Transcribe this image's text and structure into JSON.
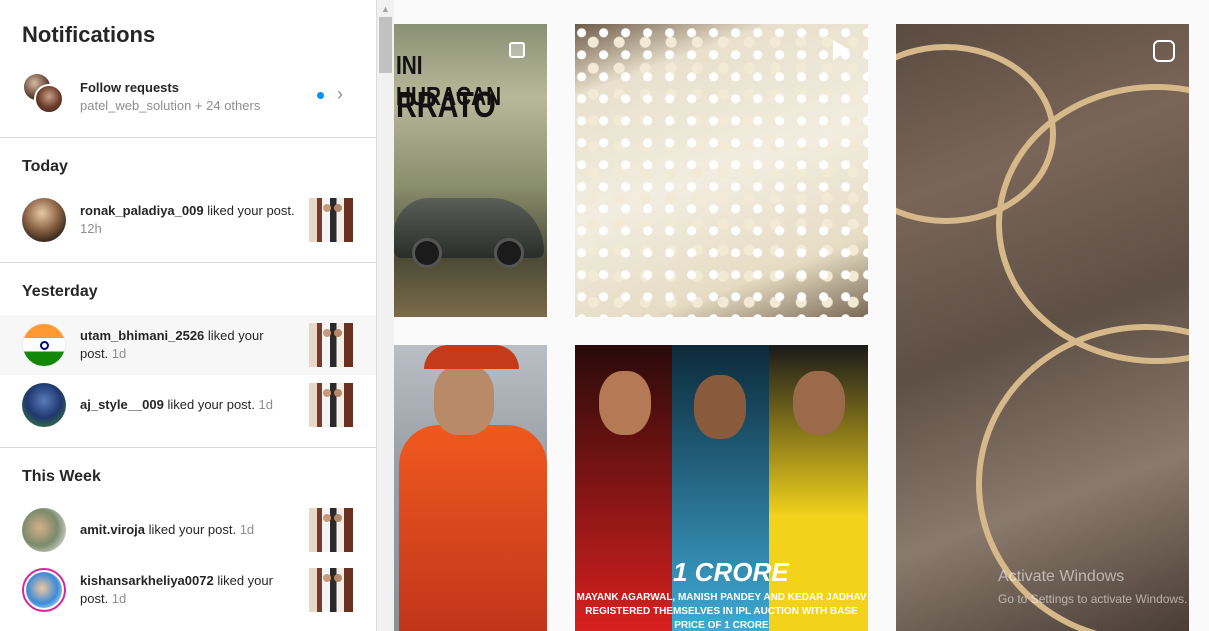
{
  "notifications": {
    "title": "Notifications",
    "follow_requests": {
      "title": "Follow requests",
      "subtitle": "patel_web_solution + 24 others"
    },
    "sections": {
      "today": "Today",
      "yesterday": "Yesterday",
      "this_week": "This Week"
    },
    "items": [
      {
        "username": "ronak_paladiya_009",
        "action": " liked your post.",
        "time": " 12h"
      },
      {
        "username": "utam_bhimani_2526",
        "action": " liked your post.",
        "time": " 1d"
      },
      {
        "username": "aj_style__009",
        "action": " liked your post.",
        "time": " 1d"
      },
      {
        "username": "amit.viroja",
        "action": " liked your post.",
        "time": " 1d"
      },
      {
        "username": "kishansarkheliya0072",
        "action": " liked your post.",
        "time": " 1d"
      }
    ]
  },
  "feed": {
    "car_title_line1": "INI HURACAN",
    "car_title_line2": "RRATO",
    "ipl_headline": "1 CRORE",
    "ipl_caption": "MAYANK AGARWAL, MANISH PANDEY AND KEDAR JADHAV REGISTERED THEMSELVES IN IPL AUCTION WITH BASE PRICE OF 1 CRORE"
  },
  "os_watermark": {
    "line1": "Activate Windows",
    "line2": "Go to Settings to activate Windows."
  },
  "colors": {
    "unread_dot": "#0095f6",
    "story_ring": "#d6249f"
  }
}
